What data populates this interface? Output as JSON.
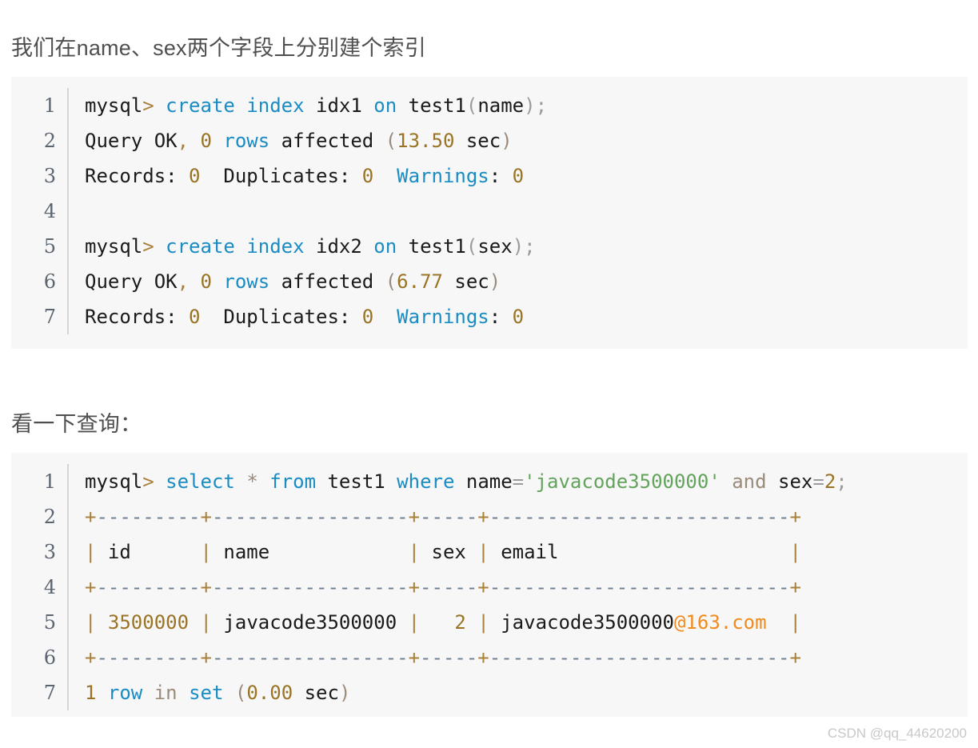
{
  "document": {
    "paragraph_1": "我们在name、sex两个字段上分别建个索引",
    "paragraph_2": "看一下查询："
  },
  "code_block_1": {
    "language": "sql",
    "line_numbers": [
      "1",
      "2",
      "3",
      "4",
      "5",
      "6",
      "7"
    ],
    "lines": [
      {
        "number": "1",
        "text": "mysql> create index idx1 on test1(name);",
        "tokens": [
          {
            "t": "mysql",
            "c": "plain"
          },
          {
            "t": ">",
            "c": "op"
          },
          {
            "t": " ",
            "c": "plain"
          },
          {
            "t": "create",
            "c": "kw"
          },
          {
            "t": " ",
            "c": "plain"
          },
          {
            "t": "index",
            "c": "kw"
          },
          {
            "t": " idx1 ",
            "c": "plain"
          },
          {
            "t": "on",
            "c": "kw"
          },
          {
            "t": " test1",
            "c": "plain"
          },
          {
            "t": "(",
            "c": "punc"
          },
          {
            "t": "name",
            "c": "plain"
          },
          {
            "t": ");",
            "c": "punc"
          }
        ]
      },
      {
        "number": "2",
        "text": "Query OK, 0 rows affected (13.50 sec)",
        "tokens": [
          {
            "t": "Query OK",
            "c": "plain"
          },
          {
            "t": ",",
            "c": "op"
          },
          {
            "t": " ",
            "c": "plain"
          },
          {
            "t": "0",
            "c": "num"
          },
          {
            "t": " ",
            "c": "plain"
          },
          {
            "t": "rows",
            "c": "kw"
          },
          {
            "t": " affected ",
            "c": "plain"
          },
          {
            "t": "(",
            "c": "com"
          },
          {
            "t": "13.50",
            "c": "num"
          },
          {
            "t": " ",
            "c": "plain"
          },
          {
            "t": "sec",
            "c": "plain"
          },
          {
            "t": ")",
            "c": "com"
          }
        ]
      },
      {
        "number": "3",
        "text": "Records: 0  Duplicates: 0  Warnings: 0",
        "tokens": [
          {
            "t": "Records: ",
            "c": "plain"
          },
          {
            "t": "0",
            "c": "num"
          },
          {
            "t": "  Duplicates: ",
            "c": "plain"
          },
          {
            "t": "0",
            "c": "num"
          },
          {
            "t": "  ",
            "c": "plain"
          },
          {
            "t": "Warnings",
            "c": "kw"
          },
          {
            "t": ": ",
            "c": "plain"
          },
          {
            "t": "0",
            "c": "num"
          }
        ]
      },
      {
        "number": "4",
        "text": "",
        "tokens": []
      },
      {
        "number": "5",
        "text": "mysql> create index idx2 on test1(sex);",
        "tokens": [
          {
            "t": "mysql",
            "c": "plain"
          },
          {
            "t": ">",
            "c": "op"
          },
          {
            "t": " ",
            "c": "plain"
          },
          {
            "t": "create",
            "c": "kw"
          },
          {
            "t": " ",
            "c": "plain"
          },
          {
            "t": "index",
            "c": "kw"
          },
          {
            "t": " idx2 ",
            "c": "plain"
          },
          {
            "t": "on",
            "c": "kw"
          },
          {
            "t": " test1",
            "c": "plain"
          },
          {
            "t": "(",
            "c": "punc"
          },
          {
            "t": "sex",
            "c": "plain"
          },
          {
            "t": ");",
            "c": "punc"
          }
        ]
      },
      {
        "number": "6",
        "text": "Query OK, 0 rows affected (6.77 sec)",
        "tokens": [
          {
            "t": "Query OK",
            "c": "plain"
          },
          {
            "t": ",",
            "c": "op"
          },
          {
            "t": " ",
            "c": "plain"
          },
          {
            "t": "0",
            "c": "num"
          },
          {
            "t": " ",
            "c": "plain"
          },
          {
            "t": "rows",
            "c": "kw"
          },
          {
            "t": " affected ",
            "c": "plain"
          },
          {
            "t": "(",
            "c": "com"
          },
          {
            "t": "6.77",
            "c": "num"
          },
          {
            "t": " ",
            "c": "plain"
          },
          {
            "t": "sec",
            "c": "plain"
          },
          {
            "t": ")",
            "c": "com"
          }
        ]
      },
      {
        "number": "7",
        "text": "Records: 0  Duplicates: 0  Warnings: 0",
        "tokens": [
          {
            "t": "Records: ",
            "c": "plain"
          },
          {
            "t": "0",
            "c": "num"
          },
          {
            "t": "  Duplicates: ",
            "c": "plain"
          },
          {
            "t": "0",
            "c": "num"
          },
          {
            "t": "  ",
            "c": "plain"
          },
          {
            "t": "Warnings",
            "c": "kw"
          },
          {
            "t": ": ",
            "c": "plain"
          },
          {
            "t": "0",
            "c": "num"
          }
        ]
      }
    ]
  },
  "code_block_2": {
    "language": "sql",
    "line_numbers": [
      "1",
      "2",
      "3",
      "4",
      "5",
      "6",
      "7"
    ],
    "lines": [
      {
        "number": "1",
        "text": "mysql> select * from test1 where name='javacode3500000' and sex=2;",
        "tokens": [
          {
            "t": "mysql",
            "c": "plain"
          },
          {
            "t": ">",
            "c": "op"
          },
          {
            "t": " ",
            "c": "plain"
          },
          {
            "t": "select",
            "c": "kw"
          },
          {
            "t": " ",
            "c": "plain"
          },
          {
            "t": "*",
            "c": "com"
          },
          {
            "t": " ",
            "c": "plain"
          },
          {
            "t": "from",
            "c": "kw"
          },
          {
            "t": " test1 ",
            "c": "plain"
          },
          {
            "t": "where",
            "c": "kw"
          },
          {
            "t": " name",
            "c": "plain"
          },
          {
            "t": "=",
            "c": "punc"
          },
          {
            "t": "'javacode3500000'",
            "c": "str"
          },
          {
            "t": " ",
            "c": "plain"
          },
          {
            "t": "and",
            "c": "com"
          },
          {
            "t": " sex",
            "c": "plain"
          },
          {
            "t": "=",
            "c": "punc"
          },
          {
            "t": "2",
            "c": "num"
          },
          {
            "t": ";",
            "c": "punc"
          }
        ]
      },
      {
        "number": "2",
        "text": "+---------+-----------------+-----+--------------------------+",
        "tokens": [
          {
            "t": "+",
            "c": "bar"
          },
          {
            "t": "---------",
            "c": "dash"
          },
          {
            "t": "+",
            "c": "bar"
          },
          {
            "t": "-----------------",
            "c": "dash"
          },
          {
            "t": "+",
            "c": "bar"
          },
          {
            "t": "-----",
            "c": "dash"
          },
          {
            "t": "+",
            "c": "bar"
          },
          {
            "t": "--------------------------",
            "c": "dash"
          },
          {
            "t": "+",
            "c": "bar"
          }
        ]
      },
      {
        "number": "3",
        "text": "| id      | name            | sex | email                    |",
        "tokens": [
          {
            "t": "|",
            "c": "bar"
          },
          {
            "t": " id      ",
            "c": "plain"
          },
          {
            "t": "|",
            "c": "bar"
          },
          {
            "t": " name            ",
            "c": "plain"
          },
          {
            "t": "|",
            "c": "bar"
          },
          {
            "t": " sex ",
            "c": "plain"
          },
          {
            "t": "|",
            "c": "bar"
          },
          {
            "t": " email                    ",
            "c": "plain"
          },
          {
            "t": "|",
            "c": "bar"
          }
        ]
      },
      {
        "number": "4",
        "text": "+---------+-----------------+-----+--------------------------+",
        "tokens": [
          {
            "t": "+",
            "c": "bar"
          },
          {
            "t": "---------",
            "c": "dash"
          },
          {
            "t": "+",
            "c": "bar"
          },
          {
            "t": "-----------------",
            "c": "dash"
          },
          {
            "t": "+",
            "c": "bar"
          },
          {
            "t": "-----",
            "c": "dash"
          },
          {
            "t": "+",
            "c": "bar"
          },
          {
            "t": "--------------------------",
            "c": "dash"
          },
          {
            "t": "+",
            "c": "bar"
          }
        ]
      },
      {
        "number": "5",
        "text": "| 3500000 | javacode3500000 |   2 | javacode3500000@163.com  |",
        "tokens": [
          {
            "t": "|",
            "c": "bar"
          },
          {
            "t": " ",
            "c": "plain"
          },
          {
            "t": "3500000",
            "c": "num"
          },
          {
            "t": " ",
            "c": "plain"
          },
          {
            "t": "|",
            "c": "bar"
          },
          {
            "t": " javacode3500000 ",
            "c": "plain"
          },
          {
            "t": "|",
            "c": "bar"
          },
          {
            "t": "   ",
            "c": "plain"
          },
          {
            "t": "2",
            "c": "num"
          },
          {
            "t": " ",
            "c": "plain"
          },
          {
            "t": "|",
            "c": "bar"
          },
          {
            "t": " javacode3500000",
            "c": "plain"
          },
          {
            "t": "@163.com",
            "c": "at"
          },
          {
            "t": "  ",
            "c": "plain"
          },
          {
            "t": "|",
            "c": "bar"
          }
        ]
      },
      {
        "number": "6",
        "text": "+---------+-----------------+-----+--------------------------+",
        "tokens": [
          {
            "t": "+",
            "c": "bar"
          },
          {
            "t": "---------",
            "c": "dash"
          },
          {
            "t": "+",
            "c": "bar"
          },
          {
            "t": "-----------------",
            "c": "dash"
          },
          {
            "t": "+",
            "c": "bar"
          },
          {
            "t": "-----",
            "c": "dash"
          },
          {
            "t": "+",
            "c": "bar"
          },
          {
            "t": "--------------------------",
            "c": "dash"
          },
          {
            "t": "+",
            "c": "bar"
          }
        ]
      },
      {
        "number": "7",
        "text": "1 row in set (0.00 sec)",
        "tokens": [
          {
            "t": "1",
            "c": "num"
          },
          {
            "t": " ",
            "c": "plain"
          },
          {
            "t": "row",
            "c": "kw"
          },
          {
            "t": " ",
            "c": "plain"
          },
          {
            "t": "in",
            "c": "com"
          },
          {
            "t": " ",
            "c": "plain"
          },
          {
            "t": "set",
            "c": "kw"
          },
          {
            "t": " ",
            "c": "plain"
          },
          {
            "t": "(",
            "c": "com"
          },
          {
            "t": "0.00",
            "c": "num"
          },
          {
            "t": " ",
            "c": "plain"
          },
          {
            "t": "sec",
            "c": "plain"
          },
          {
            "t": ")",
            "c": "com"
          }
        ]
      }
    ]
  },
  "query_result": {
    "type": "table",
    "columns": [
      "id",
      "name",
      "sex",
      "email"
    ],
    "rows": [
      [
        "3500000",
        "javacode3500000",
        "2",
        "javacode3500000@163.com"
      ]
    ],
    "row_count_text": "1 row in set (0.00 sec)"
  },
  "watermark": {
    "text": "CSDN @qq_44620200"
  },
  "colors": {
    "page_background": "#ffffff",
    "code_background": "#f7f7f8",
    "prose_text": "#4f4f4f",
    "code_text": "#1a1a1a",
    "gutter_text": "#5b6570",
    "gutter_divider": "#d2d6da",
    "keyword": "#1a8cc4",
    "number": "#9a7424",
    "string": "#63a35c",
    "comment": "#9b8b7a",
    "punctuation": "#9b9b9b",
    "operator": "#a9813a",
    "at_domain": "#f08b1d",
    "table_bar": "#a9813a",
    "table_dash": "#6b7c93",
    "watermark": "#c8c8c8"
  }
}
